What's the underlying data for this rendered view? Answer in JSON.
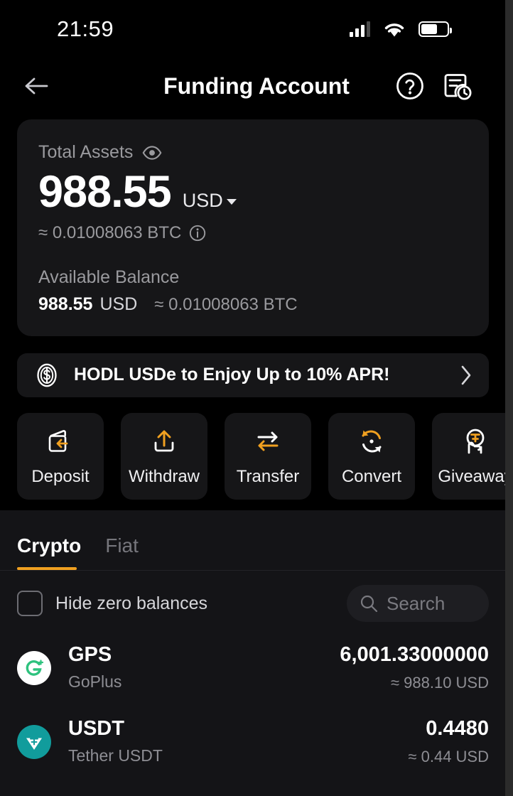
{
  "status_bar": {
    "time": "21:59",
    "signal_icon": "signal-bars-icon",
    "wifi_icon": "wifi-icon",
    "battery_icon": "battery-icon"
  },
  "nav": {
    "back_icon": "back-arrow-icon",
    "title": "Funding Account",
    "help_icon": "help-circle-icon",
    "history_icon": "order-history-icon"
  },
  "balance_card": {
    "label": "Total Assets",
    "eye_icon": "eye-icon",
    "amount": "988.55",
    "currency": "USD",
    "approx_btc": "≈ 0.01008063 BTC",
    "info_icon": "info-icon",
    "available_label": "Available Balance",
    "available_amount": "988.55",
    "available_unit": "USD",
    "available_btc": "≈ 0.01008063 BTC"
  },
  "promo": {
    "icon": "dollar-coin-icon",
    "text": "HODL USDe to Enjoy Up to 10% APR!",
    "chevron_icon": "chevron-right-icon"
  },
  "actions": [
    {
      "label": "Deposit",
      "icon": "deposit-wallet-icon"
    },
    {
      "label": "Withdraw",
      "icon": "withdraw-upload-icon"
    },
    {
      "label": "Transfer",
      "icon": "transfer-arrows-icon"
    },
    {
      "label": "Convert",
      "icon": "convert-refresh-icon"
    },
    {
      "label": "Giveaway",
      "icon": "giveaway-hand-token-icon"
    }
  ],
  "tabs": [
    {
      "label": "Crypto",
      "active": true
    },
    {
      "label": "Fiat",
      "active": false
    }
  ],
  "filters": {
    "hide_zero_label": "Hide zero balances",
    "hide_zero_checked": false,
    "search_icon": "search-icon",
    "search_placeholder": "Search",
    "search_value": ""
  },
  "assets": [
    {
      "symbol": "GPS",
      "name": "GoPlus",
      "amount": "6,001.33000000",
      "usd": "≈ 988.10 USD",
      "icon": "gps-coin-icon",
      "icon_bg": "#ffffff",
      "icon_fg": "#2ec27e"
    },
    {
      "symbol": "USDT",
      "name": "Tether USDT",
      "amount": "0.4480",
      "usd": "≈ 0.44 USD",
      "icon": "usdt-coin-icon",
      "icon_bg": "#119c9c",
      "icon_fg": "#ffffff"
    }
  ],
  "theme": {
    "accent": "#f0a020",
    "background": "#000000",
    "card": "#161618",
    "panel": "#141417"
  }
}
